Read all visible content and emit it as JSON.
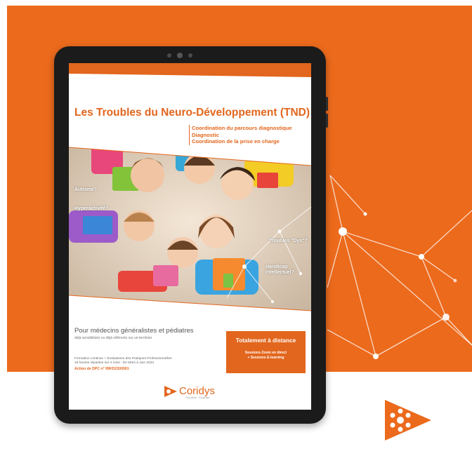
{
  "brochure": {
    "title": "Les Troubles du Neuro-Développement (TND)",
    "bullets": [
      "Coordination du parcours diagnostique",
      "Diagnostic",
      "Coordination de la prise en charge"
    ],
    "tags": {
      "autisme": "Autisme?",
      "hyperactivite": "Hyperactivité?",
      "dys": "Troubles \"Dys\"?",
      "handicap_line1": "Handicap",
      "handicap_line2": "intellectuel?"
    },
    "audience": "Pour médecins généralistes et pédiatres",
    "audience_sub": "déjà sensibilisés ou déjà référents sur un territoire",
    "info_line1": "Formation continue + Evaluations des Pratiques Professionnelles",
    "info_line2": "18 heures réparties sur 4 mois : De Mars à Juin 2024",
    "dpc": "Action de DPC n° 99KD2300001",
    "distance": {
      "heading": "Totalement à distance",
      "line1": "Sessions Zoom en direct",
      "line2": "+ Sessions E-learning"
    },
    "logo": {
      "brand": "Coridys",
      "tagline": "Formation · Expertise"
    }
  },
  "colors": {
    "brand_orange": "#e2661d",
    "background_orange": "#ec6a1c",
    "tablet_frame": "#1b1b1b"
  }
}
